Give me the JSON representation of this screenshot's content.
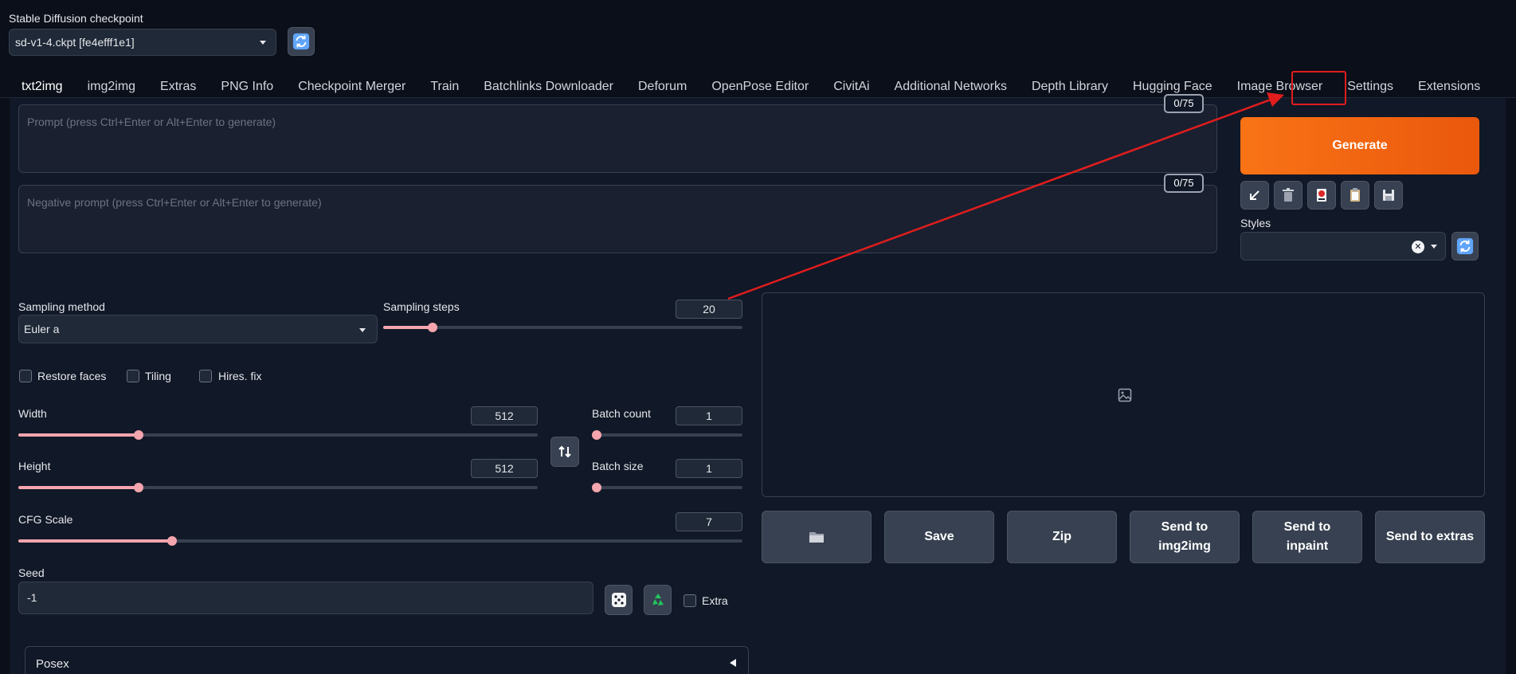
{
  "checkpoint": {
    "label": "Stable Diffusion checkpoint",
    "value": "sd-v1-4.ckpt [fe4efff1e1]"
  },
  "tabs": [
    {
      "label": "txt2img",
      "active": true
    },
    {
      "label": "img2img"
    },
    {
      "label": "Extras"
    },
    {
      "label": "PNG Info"
    },
    {
      "label": "Checkpoint Merger"
    },
    {
      "label": "Train"
    },
    {
      "label": "Batchlinks Downloader"
    },
    {
      "label": "Deforum"
    },
    {
      "label": "OpenPose Editor"
    },
    {
      "label": "CivitAi"
    },
    {
      "label": "Additional Networks"
    },
    {
      "label": "Depth Library"
    },
    {
      "label": "Hugging Face"
    },
    {
      "label": "Image Browser"
    },
    {
      "label": "Settings",
      "highlighted": true
    },
    {
      "label": "Extensions"
    }
  ],
  "prompt": {
    "placeholder": "Prompt (press Ctrl+Enter or Alt+Enter to generate)",
    "token_count": "0/75"
  },
  "negative_prompt": {
    "placeholder": "Negative prompt (press Ctrl+Enter or Alt+Enter to generate)",
    "token_count": "0/75"
  },
  "generate": {
    "label": "Generate"
  },
  "styles": {
    "label": "Styles",
    "clear_glyph": "✕"
  },
  "sampling": {
    "method_label": "Sampling method",
    "method_value": "Euler a",
    "steps_label": "Sampling steps",
    "steps_value": "20",
    "steps_fraction": 0.137
  },
  "checkboxes": {
    "restore_faces": "Restore faces",
    "tiling": "Tiling",
    "hires_fix": "Hires. fix"
  },
  "width": {
    "label": "Width",
    "value": "512",
    "fraction": 0.232
  },
  "height": {
    "label": "Height",
    "value": "512",
    "fraction": 0.232
  },
  "batch_count": {
    "label": "Batch count",
    "value": "1",
    "fraction": 0.0
  },
  "batch_size": {
    "label": "Batch size",
    "value": "1",
    "fraction": 0.0
  },
  "cfg_scale": {
    "label": "CFG Scale",
    "value": "7",
    "fraction": 0.212
  },
  "seed": {
    "label": "Seed",
    "value": "-1",
    "extra_label": "Extra"
  },
  "output_buttons": {
    "save": "Save",
    "zip": "Zip",
    "send_img2img_line1": "Send to",
    "send_img2img_line2": "img2img",
    "send_inpaint_line1": "Send to",
    "send_inpaint_line2": "inpaint",
    "send_extras": "Send to extras"
  },
  "posex": {
    "label": "Posex"
  },
  "colors": {
    "accent": "#f4a5ae",
    "generate": "#ea580c",
    "annotation": "#e11d1d"
  }
}
